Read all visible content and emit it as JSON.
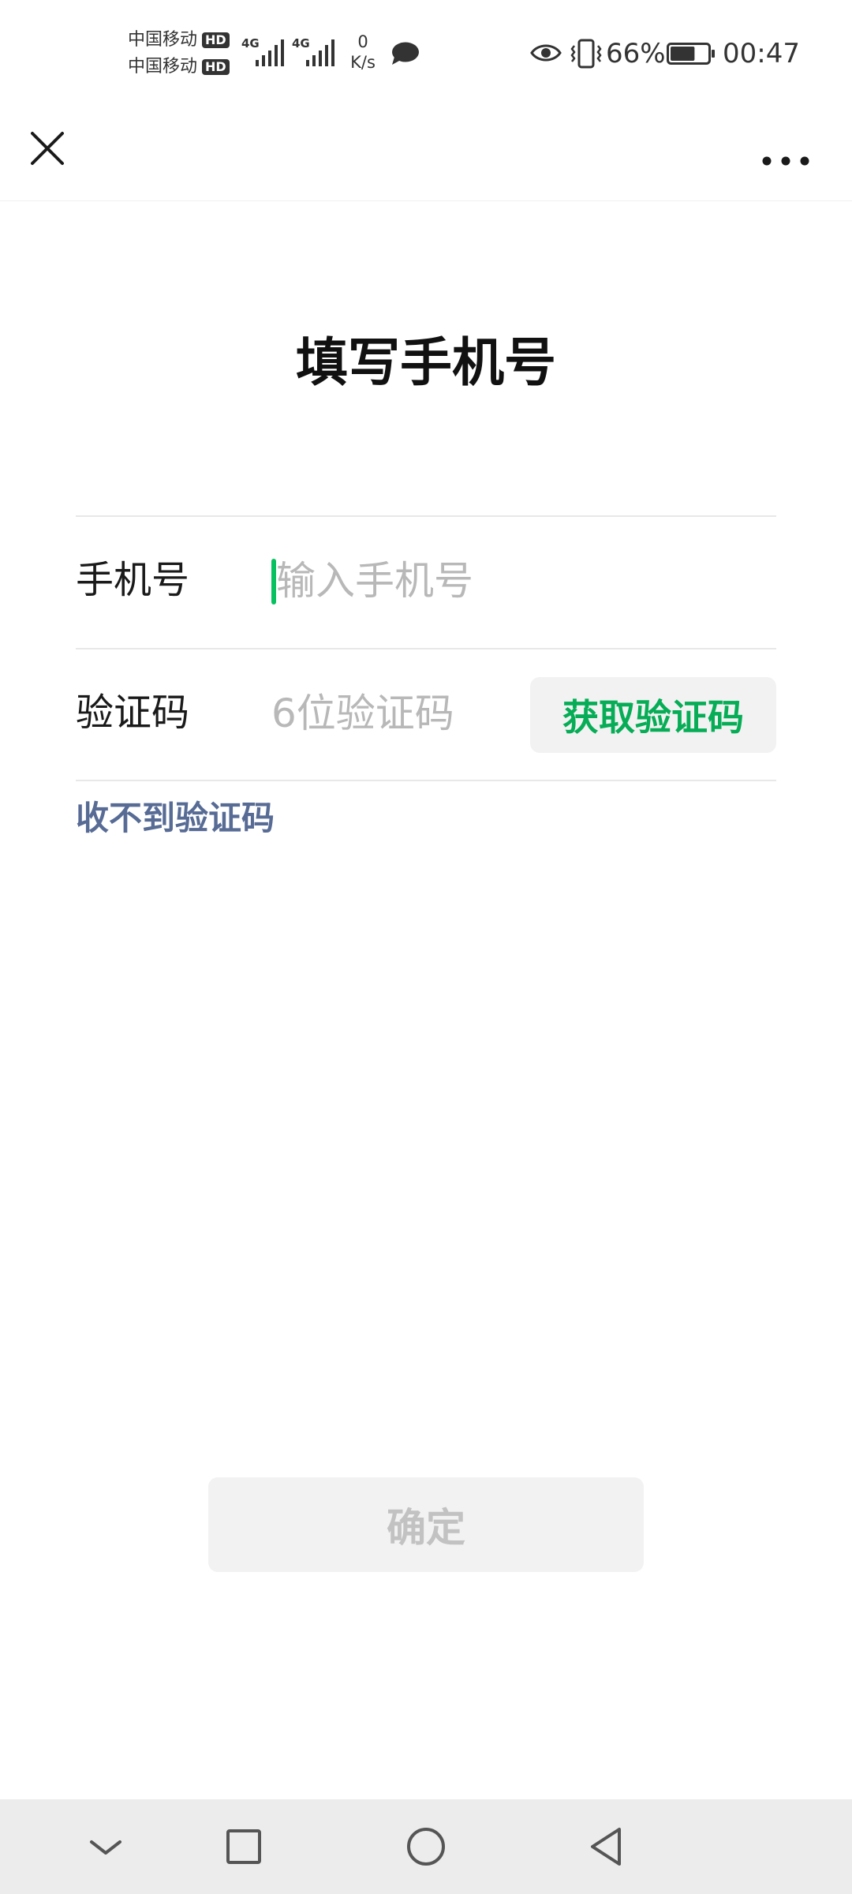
{
  "status_bar": {
    "carrier_1": "中国移动",
    "carrier_2": "中国移动",
    "hd_badge": "HD",
    "network_1": "4G",
    "network_2": "4G",
    "net_speed_value": "0",
    "net_speed_unit": "K/s",
    "battery_percent": "66%",
    "battery_level": 0.66,
    "time": "00:47"
  },
  "page": {
    "title": "填写手机号"
  },
  "form": {
    "phone_label": "手机号",
    "phone_placeholder": "输入手机号",
    "phone_value": "",
    "code_label": "验证码",
    "code_placeholder": "6位验证码",
    "code_value": "",
    "get_code_button": "获取验证码",
    "no_code_link": "收不到验证码",
    "confirm_button": "确定"
  },
  "icons": {
    "close": "close-icon",
    "more": "more-icon",
    "chat_notification": "chat-bubble-icon",
    "eye_comfort": "eye-icon",
    "vibrate": "vibrate-icon",
    "battery": "battery-icon",
    "nav_down": "chevron-down-icon",
    "nav_recents": "square-icon",
    "nav_home": "circle-icon",
    "nav_back": "back-triangle-icon"
  },
  "colors": {
    "accent_green": "#07c160",
    "button_text_green": "#06ad56",
    "link_blue": "#576b95",
    "button_bg": "#f2f2f2",
    "disabled_text": "#c2c2c2",
    "placeholder": "#b8b8b8"
  }
}
